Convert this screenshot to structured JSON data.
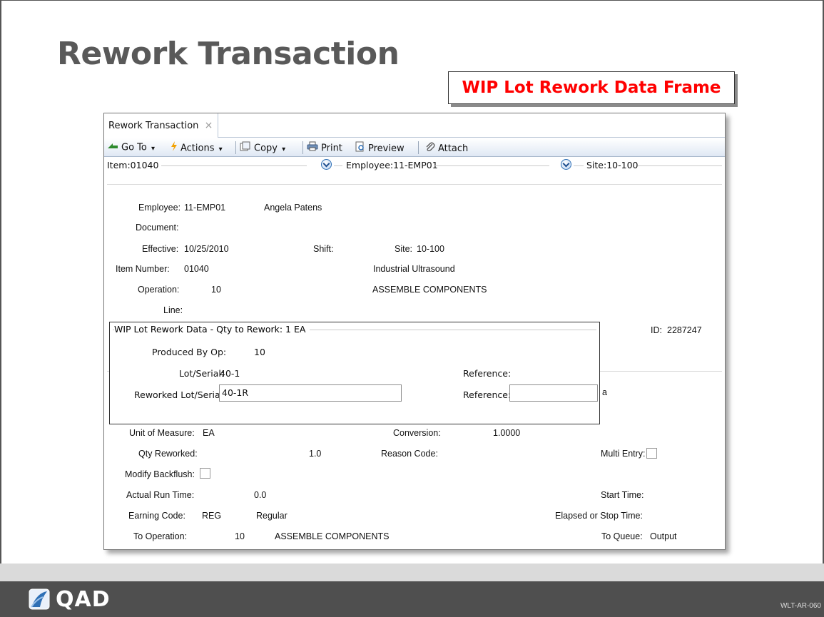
{
  "slide": {
    "title": "Rework Transaction",
    "callout": "WIP Lot Rework Data Frame",
    "footer_logo": "QAD",
    "slide_code": "WLT-AR-060"
  },
  "window": {
    "tab_label": "Rework Transaction",
    "tab_close_glyph": "×",
    "toolbar": {
      "goto": "Go To",
      "actions": "Actions",
      "copy": "Copy",
      "print": "Print",
      "preview": "Preview",
      "attach": "Attach",
      "dropdown_glyph": "▾"
    },
    "filters": {
      "item": "Item:01040",
      "employee": "Employee:11-EMP01",
      "site": "Site:10-100"
    }
  },
  "form": {
    "employee_label": "Employee:",
    "employee_value": "11-EMP01",
    "employee_name": "Angela Patens",
    "document_label": "Document:",
    "effective_label": "Effective:",
    "effective_value": "10/25/2010",
    "shift_label": "Shift:",
    "site_label": "Site:",
    "site_value": "10-100",
    "item_label": "Item Number:",
    "item_value": "01040",
    "item_desc": "Industrial Ultrasound",
    "operation_label": "Operation:",
    "operation_value": "10",
    "operation_desc": "ASSEMBLE COMPONENTS",
    "line_label": "Line:",
    "id_label": "ID:",
    "id_value": "2287247",
    "uom_label": "Unit of Measure:",
    "uom_value": "EA",
    "conversion_label": "Conversion:",
    "conversion_value": "1.0000",
    "qty_label": "Qty Reworked:",
    "qty_value": "1.0",
    "reason_label": "Reason Code:",
    "multi_entry_label": "Multi Entry:",
    "modify_backflush_label": "Modify Backflush:",
    "run_time_label": "Actual Run Time:",
    "run_time_value": "0.0",
    "start_time_label": "Start Time:",
    "earning_label": "Earning Code:",
    "earning_value": "REG",
    "earning_desc": "Regular",
    "elapsed_label": "Elapsed or Stop Time:",
    "to_op_label": "To Operation:",
    "to_op_value": "10",
    "to_op_desc": "ASSEMBLE COMPONENTS",
    "to_queue_label": "To Queue:",
    "to_queue_value": "Output",
    "hidden_glimpse": "a"
  },
  "wip_frame": {
    "legend": "WIP Lot Rework Data - Qty to Rework: 1 EA",
    "produced_by_label": "Produced By Op:",
    "produced_by_value": "10",
    "lot_label": "Lot/Serial:",
    "lot_value": "40-1",
    "reference_label": "Reference:",
    "reworked_lot_label": "Reworked Lot/Serial:",
    "reworked_lot_value": "40-1R",
    "reference2_label": "Reference:",
    "reference2_value": ""
  }
}
